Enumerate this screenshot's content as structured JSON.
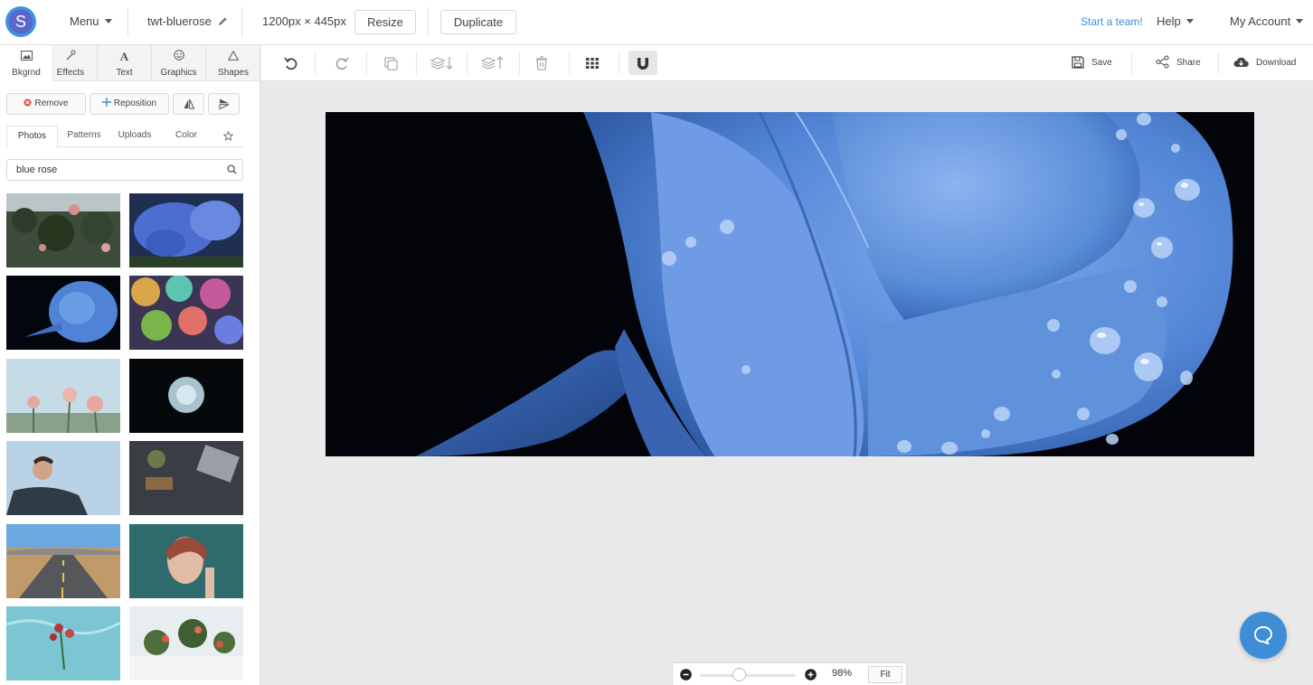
{
  "header": {
    "logo_letter": "S",
    "menu_label": "Menu",
    "design_name": "twt-bluerose",
    "dimensions": "1200px × 445px",
    "resize_label": "Resize",
    "duplicate_label": "Duplicate",
    "start_team_label": "Start a team!",
    "help_label": "Help",
    "account_label": "My Account"
  },
  "tool_tabs": [
    {
      "label": "Bkgrnd",
      "icon": "image-icon"
    },
    {
      "label": "Effects",
      "icon": "wand-icon"
    },
    {
      "label": "Text",
      "icon": "text-icon"
    },
    {
      "label": "Graphics",
      "icon": "smiley-icon"
    },
    {
      "label": "Shapes",
      "icon": "triangle-icon"
    }
  ],
  "background_panel": {
    "remove_label": "Remove",
    "reposition_label": "Reposition",
    "sub_tabs": [
      "Photos",
      "Patterns",
      "Uploads",
      "Color"
    ],
    "search_value": "blue rose"
  },
  "toolbar": {
    "save_label": "Save",
    "share_label": "Share",
    "download_label": "Download"
  },
  "zoom": {
    "percent_label": "98%",
    "fit_label": "Fit",
    "level": 0.41
  },
  "colors": {
    "accent": "#3f8ed8",
    "canvas_bg": "#02040a",
    "rose_blue": "#5a8ed8"
  }
}
